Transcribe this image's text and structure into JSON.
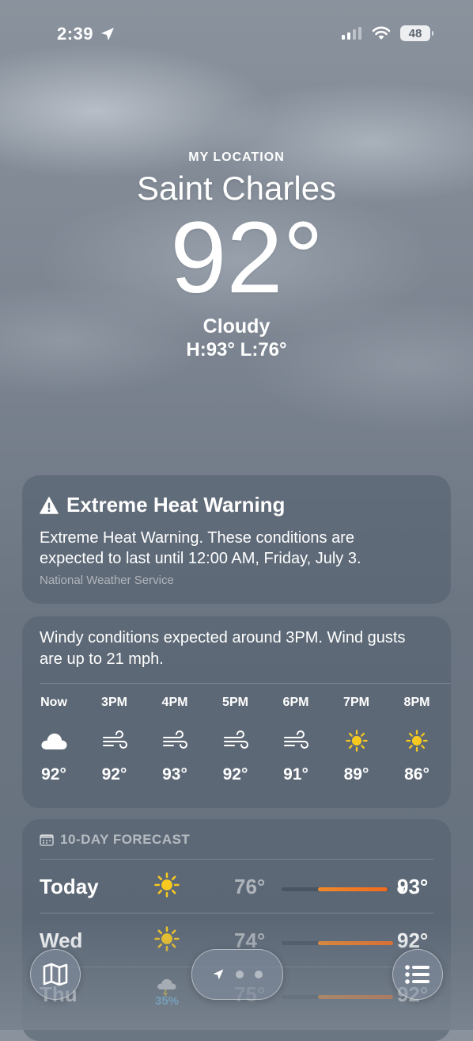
{
  "status_bar": {
    "time": "2:39",
    "battery": "48",
    "icons": [
      "location-arrow-icon",
      "signal-icon",
      "wifi-icon",
      "battery-icon"
    ]
  },
  "header": {
    "location_label": "MY LOCATION",
    "city": "Saint Charles",
    "temperature": "92°",
    "condition": "Cloudy",
    "high_low": "H:93°  L:76°"
  },
  "alert": {
    "title": "Extreme Heat Warning",
    "body": "Extreme Heat Warning. These conditions are expected to last until 12:00 AM, Friday, July 3.",
    "source": "National Weather Service",
    "icon": "warning-triangle-icon"
  },
  "hourly": {
    "summary": "Windy conditions expected around 3PM. Wind gusts are up to 21 mph.",
    "hours": [
      {
        "label": "Now",
        "icon": "cloud-icon",
        "temp": "92°"
      },
      {
        "label": "3PM",
        "icon": "wind-icon",
        "temp": "92°"
      },
      {
        "label": "4PM",
        "icon": "wind-icon",
        "temp": "93°"
      },
      {
        "label": "5PM",
        "icon": "wind-icon",
        "temp": "92°"
      },
      {
        "label": "6PM",
        "icon": "wind-icon",
        "temp": "91°"
      },
      {
        "label": "7PM",
        "icon": "sun-icon",
        "temp": "89°"
      },
      {
        "label": "8PM",
        "icon": "sun-icon",
        "temp": "86°"
      }
    ]
  },
  "daily": {
    "header": "10-DAY FORECAST",
    "days": [
      {
        "day": "Today",
        "icon": "sun-icon",
        "precip": "",
        "low": "76°",
        "high": "93°",
        "range_start": 0.0,
        "range_end": 0.65,
        "current": 0.62
      },
      {
        "day": "Wed",
        "icon": "sun-icon",
        "precip": "",
        "low": "74°",
        "high": "92°",
        "range_start": 0.0,
        "range_end": 0.7,
        "current": null
      },
      {
        "day": "Thu",
        "icon": "thunderstorm-icon",
        "precip": "35%",
        "low": "75°",
        "high": "92°",
        "range_start": 0.0,
        "range_end": 0.7,
        "current": null
      }
    ]
  },
  "toolbar": {
    "map_icon": "map-icon",
    "list_icon": "list-icon",
    "page_indicator_icon": "location-arrow-icon"
  },
  "colors": {
    "sun": "#f7c81f",
    "bar": "#f07a26",
    "precip": "#6bc7f5"
  }
}
